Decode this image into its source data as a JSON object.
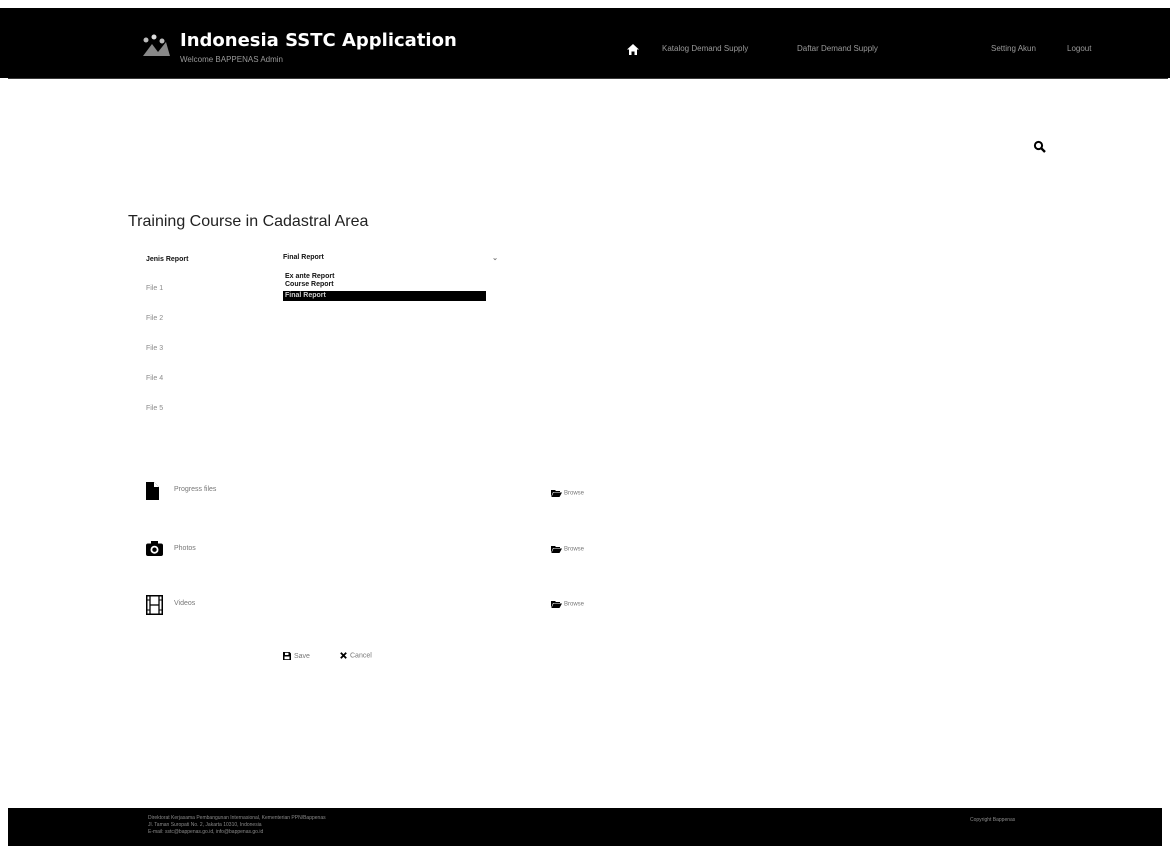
{
  "header": {
    "title": "Indonesia SSTC Application",
    "subtitle": "Welcome BAPPENAS Admin",
    "nav": [
      "Katalog Demand Supply",
      "Daftar Demand Supply"
    ],
    "user_link": "Setting Akun",
    "logout": "Logout"
  },
  "page": {
    "title": "Training Course in Cadastral Area",
    "report_label": "Jenis Report",
    "report_selected": "Final Report",
    "report_options": [
      "Ex ante Report",
      "Course Report",
      "Final Report"
    ],
    "files": [
      "File 1",
      "File 2",
      "File 3",
      "File 4",
      "File 5"
    ]
  },
  "uploads": [
    {
      "label": "Progress files",
      "icon": "file-icon",
      "browse": "Browse"
    },
    {
      "label": "Photos",
      "icon": "camera-icon",
      "browse": "Browse"
    },
    {
      "label": "Videos",
      "icon": "film-icon",
      "browse": "Browse"
    }
  ],
  "actions": {
    "save": "Save",
    "cancel": "Cancel"
  },
  "footer": {
    "lines": [
      "Direktorat Kerjasama Pembangunan Internasional, Kementerian PPN/Bappenas",
      "Jl. Taman Suropati No. 2, Jakarta 10310, Indonesia",
      "E-mail: sstc@bappenas.go.id, info@bappenas.go.id"
    ],
    "right": "Copyright Bappenas"
  },
  "colors": {
    "bar": "#000000",
    "text_muted": "#9a9a9a"
  }
}
